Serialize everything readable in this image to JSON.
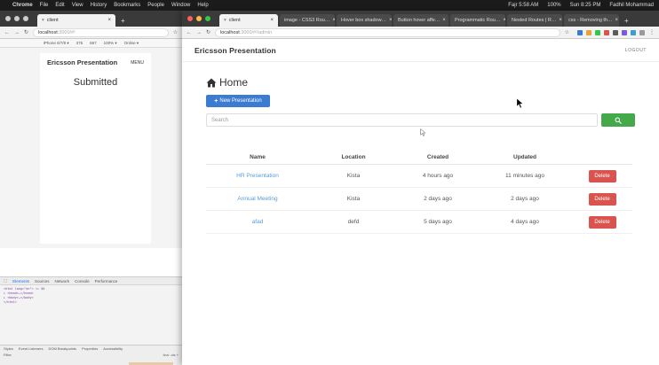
{
  "menubar": {
    "items": [
      "Chrome",
      "File",
      "Edit",
      "View",
      "History",
      "Bookmarks",
      "People",
      "Window",
      "Help"
    ],
    "status": [
      "Fajr 5:58 AM",
      "100%",
      "Sun 8:25 PM",
      "Fadhil Mohammad"
    ]
  },
  "left_window": {
    "tab": "client",
    "url": "localhost",
    "url_port": ":3000/#!",
    "device_bar": [
      "iPhone 6/7/8 ▾",
      "375",
      "667",
      "100% ▾",
      "Online ▾"
    ],
    "app_brand": "Ericsson Presentation",
    "app_menu": "MENU",
    "page_title": "Submitted",
    "devtools_tabs": [
      "Elements",
      "Sources",
      "Network",
      "Console",
      "Performance"
    ],
    "devtools_code": [
      "<html lang=\"en\"> == $0",
      "▸ <head>…</head>",
      "▸ <body>…</body>",
      "</html>"
    ],
    "devtools_lower_tabs": [
      "Styles",
      "Event Listeners",
      "DOM Breakpoints",
      "Properties",
      "Accessibility"
    ],
    "devtools_filter": "Filter",
    "devtools_hov": ":hov .cls +"
  },
  "right_window": {
    "tabs": [
      "client",
      "image - CSS3 Rou…",
      "Hover box shadow…",
      "Button hover affe…",
      "Programmatic Rou…",
      "Nested Routes | R…",
      "css - Removing th…"
    ],
    "url": "localhost",
    "url_port": ":3000/#!/admin",
    "app": {
      "brand": "Ericsson Presentation",
      "logout": "LOGOUT",
      "page_title": "Home",
      "new_button": "New Presentation",
      "search_placeholder": "Search",
      "columns": [
        "Name",
        "Location",
        "Created",
        "Updated"
      ],
      "rows": [
        {
          "name": "HR Presentation",
          "location": "Kista",
          "created": "4 hours ago",
          "updated": "11 minutes ago",
          "action": "Delete"
        },
        {
          "name": "Annual Meeting",
          "location": "Kista",
          "created": "2 days ago",
          "updated": "2 days ago",
          "action": "Delete"
        },
        {
          "name": "afad",
          "location": "defd",
          "created": "5 days ago",
          "updated": "4 days ago",
          "action": "Delete"
        }
      ]
    }
  },
  "colors": {
    "primary": "#3b7bd1",
    "success": "#44a94a",
    "danger": "#d9534f",
    "link": "#5a9bd6"
  }
}
